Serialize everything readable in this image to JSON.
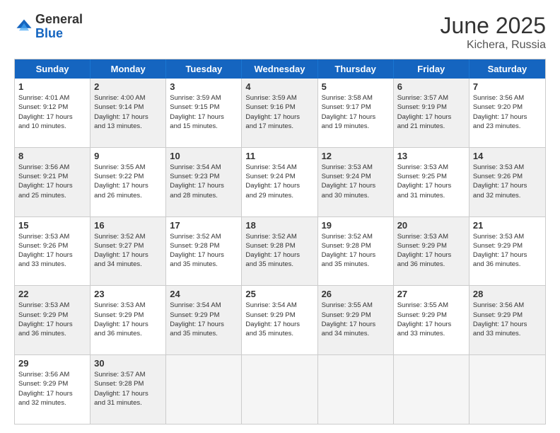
{
  "header": {
    "logo_general": "General",
    "logo_blue": "Blue",
    "month_title": "June 2025",
    "location": "Kichera, Russia"
  },
  "weekdays": [
    "Sunday",
    "Monday",
    "Tuesday",
    "Wednesday",
    "Thursday",
    "Friday",
    "Saturday"
  ],
  "rows": [
    [
      {
        "day": "1",
        "info": "Sunrise: 4:01 AM\nSunset: 9:12 PM\nDaylight: 17 hours\nand 10 minutes.",
        "shaded": false
      },
      {
        "day": "2",
        "info": "Sunrise: 4:00 AM\nSunset: 9:14 PM\nDaylight: 17 hours\nand 13 minutes.",
        "shaded": true
      },
      {
        "day": "3",
        "info": "Sunrise: 3:59 AM\nSunset: 9:15 PM\nDaylight: 17 hours\nand 15 minutes.",
        "shaded": false
      },
      {
        "day": "4",
        "info": "Sunrise: 3:59 AM\nSunset: 9:16 PM\nDaylight: 17 hours\nand 17 minutes.",
        "shaded": true
      },
      {
        "day": "5",
        "info": "Sunrise: 3:58 AM\nSunset: 9:17 PM\nDaylight: 17 hours\nand 19 minutes.",
        "shaded": false
      },
      {
        "day": "6",
        "info": "Sunrise: 3:57 AM\nSunset: 9:19 PM\nDaylight: 17 hours\nand 21 minutes.",
        "shaded": true
      },
      {
        "day": "7",
        "info": "Sunrise: 3:56 AM\nSunset: 9:20 PM\nDaylight: 17 hours\nand 23 minutes.",
        "shaded": false
      }
    ],
    [
      {
        "day": "8",
        "info": "Sunrise: 3:56 AM\nSunset: 9:21 PM\nDaylight: 17 hours\nand 25 minutes.",
        "shaded": true
      },
      {
        "day": "9",
        "info": "Sunrise: 3:55 AM\nSunset: 9:22 PM\nDaylight: 17 hours\nand 26 minutes.",
        "shaded": false
      },
      {
        "day": "10",
        "info": "Sunrise: 3:54 AM\nSunset: 9:23 PM\nDaylight: 17 hours\nand 28 minutes.",
        "shaded": true
      },
      {
        "day": "11",
        "info": "Sunrise: 3:54 AM\nSunset: 9:24 PM\nDaylight: 17 hours\nand 29 minutes.",
        "shaded": false
      },
      {
        "day": "12",
        "info": "Sunrise: 3:53 AM\nSunset: 9:24 PM\nDaylight: 17 hours\nand 30 minutes.",
        "shaded": true
      },
      {
        "day": "13",
        "info": "Sunrise: 3:53 AM\nSunset: 9:25 PM\nDaylight: 17 hours\nand 31 minutes.",
        "shaded": false
      },
      {
        "day": "14",
        "info": "Sunrise: 3:53 AM\nSunset: 9:26 PM\nDaylight: 17 hours\nand 32 minutes.",
        "shaded": true
      }
    ],
    [
      {
        "day": "15",
        "info": "Sunrise: 3:53 AM\nSunset: 9:26 PM\nDaylight: 17 hours\nand 33 minutes.",
        "shaded": false
      },
      {
        "day": "16",
        "info": "Sunrise: 3:52 AM\nSunset: 9:27 PM\nDaylight: 17 hours\nand 34 minutes.",
        "shaded": true
      },
      {
        "day": "17",
        "info": "Sunrise: 3:52 AM\nSunset: 9:28 PM\nDaylight: 17 hours\nand 35 minutes.",
        "shaded": false
      },
      {
        "day": "18",
        "info": "Sunrise: 3:52 AM\nSunset: 9:28 PM\nDaylight: 17 hours\nand 35 minutes.",
        "shaded": true
      },
      {
        "day": "19",
        "info": "Sunrise: 3:52 AM\nSunset: 9:28 PM\nDaylight: 17 hours\nand 35 minutes.",
        "shaded": false
      },
      {
        "day": "20",
        "info": "Sunrise: 3:53 AM\nSunset: 9:29 PM\nDaylight: 17 hours\nand 36 minutes.",
        "shaded": true
      },
      {
        "day": "21",
        "info": "Sunrise: 3:53 AM\nSunset: 9:29 PM\nDaylight: 17 hours\nand 36 minutes.",
        "shaded": false
      }
    ],
    [
      {
        "day": "22",
        "info": "Sunrise: 3:53 AM\nSunset: 9:29 PM\nDaylight: 17 hours\nand 36 minutes.",
        "shaded": true
      },
      {
        "day": "23",
        "info": "Sunrise: 3:53 AM\nSunset: 9:29 PM\nDaylight: 17 hours\nand 36 minutes.",
        "shaded": false
      },
      {
        "day": "24",
        "info": "Sunrise: 3:54 AM\nSunset: 9:29 PM\nDaylight: 17 hours\nand 35 minutes.",
        "shaded": true
      },
      {
        "day": "25",
        "info": "Sunrise: 3:54 AM\nSunset: 9:29 PM\nDaylight: 17 hours\nand 35 minutes.",
        "shaded": false
      },
      {
        "day": "26",
        "info": "Sunrise: 3:55 AM\nSunset: 9:29 PM\nDaylight: 17 hours\nand 34 minutes.",
        "shaded": true
      },
      {
        "day": "27",
        "info": "Sunrise: 3:55 AM\nSunset: 9:29 PM\nDaylight: 17 hours\nand 33 minutes.",
        "shaded": false
      },
      {
        "day": "28",
        "info": "Sunrise: 3:56 AM\nSunset: 9:29 PM\nDaylight: 17 hours\nand 33 minutes.",
        "shaded": true
      }
    ],
    [
      {
        "day": "29",
        "info": "Sunrise: 3:56 AM\nSunset: 9:29 PM\nDaylight: 17 hours\nand 32 minutes.",
        "shaded": false
      },
      {
        "day": "30",
        "info": "Sunrise: 3:57 AM\nSunset: 9:28 PM\nDaylight: 17 hours\nand 31 minutes.",
        "shaded": true
      },
      {
        "day": "",
        "info": "",
        "shaded": true,
        "empty": true
      },
      {
        "day": "",
        "info": "",
        "shaded": true,
        "empty": true
      },
      {
        "day": "",
        "info": "",
        "shaded": true,
        "empty": true
      },
      {
        "day": "",
        "info": "",
        "shaded": true,
        "empty": true
      },
      {
        "day": "",
        "info": "",
        "shaded": true,
        "empty": true
      }
    ]
  ]
}
